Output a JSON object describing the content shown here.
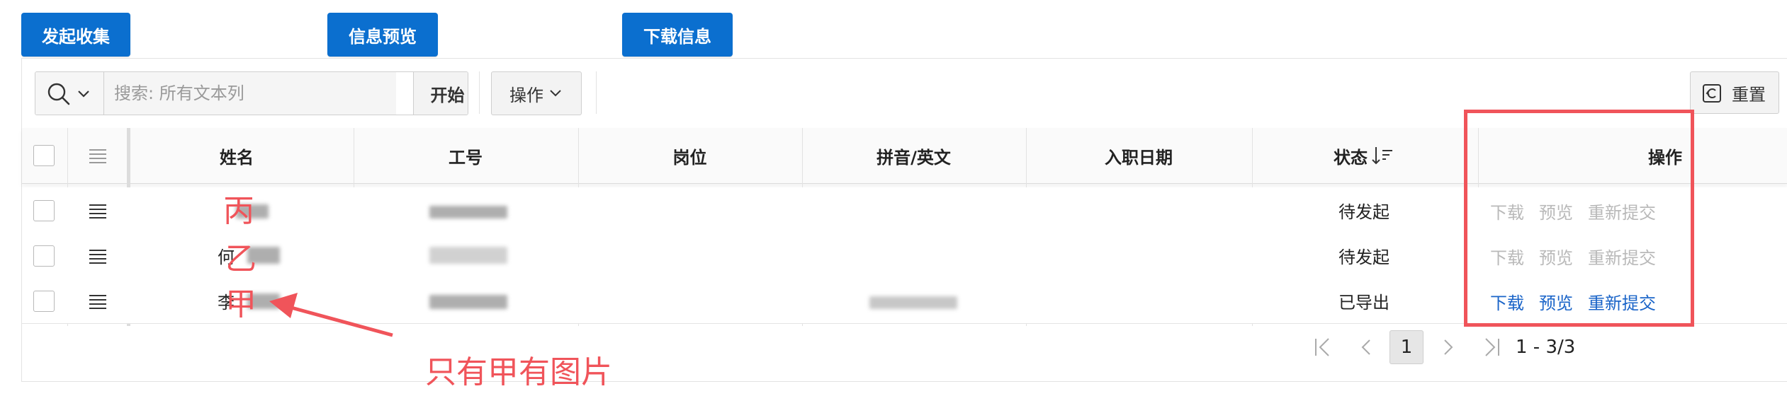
{
  "top_buttons": {
    "start_collect": "发起收集",
    "info_preview": "信息预览",
    "download_info": "下载信息"
  },
  "toolbar": {
    "search_placeholder": "搜索: 所有文本列",
    "go_label": "开始",
    "actions_label": "操作",
    "reset_label": "重置"
  },
  "table": {
    "headers": {
      "name": "姓名",
      "employee_id": "工号",
      "position": "岗位",
      "pinyin": "拼音/英文",
      "hire_date": "入职日期",
      "status": "状态",
      "actions": "操作"
    },
    "rows": [
      {
        "name": "",
        "status": "待发起",
        "actions_enabled": false
      },
      {
        "name": "何",
        "status": "待发起",
        "actions_enabled": false
      },
      {
        "name": "李",
        "status": "已导出",
        "actions_enabled": true
      }
    ],
    "row_actions": {
      "download": "下载",
      "preview": "预览",
      "resubmit": "重新提交"
    }
  },
  "pagination": {
    "current_page": "1",
    "range": "1 - 3/3"
  },
  "annotations": {
    "labels": [
      "丙",
      "乙",
      "甲"
    ],
    "note": "只有甲有图片",
    "color": "#f0545a"
  },
  "colors": {
    "primary": "#0b6fcf",
    "link": "#1a64c8",
    "disabled": "#b9b9b9"
  }
}
